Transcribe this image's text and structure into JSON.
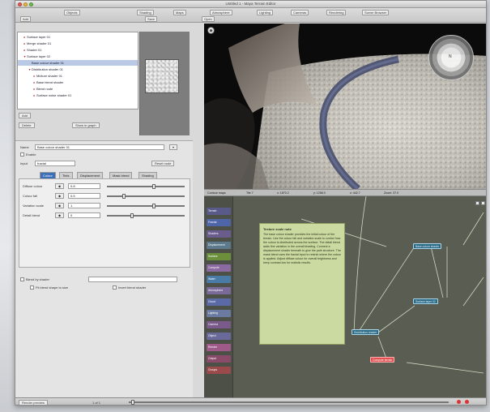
{
  "window": {
    "title": "Untitled 1 - Maya Terrain Editor"
  },
  "toolbar": {
    "top_buttons": [
      "Objects",
      "Shading",
      "Maps",
      "Atmosphere",
      "Lighting",
      "Cameras",
      "Rendering",
      "Scene Browser"
    ],
    "small_buttons": [
      "Add",
      "Save",
      "Open"
    ]
  },
  "outliner": {
    "items": [
      {
        "label": "Surface layer 01",
        "indent": 1,
        "toggle": "▸"
      },
      {
        "label": "Merge shader 01",
        "indent": 1,
        "toggle": "▸"
      },
      {
        "label": "Shader 01",
        "indent": 1,
        "toggle": "▸"
      },
      {
        "label": "Surface layer 02",
        "indent": 1,
        "toggle": "▾"
      },
      {
        "label": "Base colour shader 01",
        "indent": 2,
        "toggle": "",
        "selected": true
      },
      {
        "label": "Distribution shader 01",
        "indent": 2,
        "toggle": "▾"
      },
      {
        "label": "Mixture shader 01",
        "indent": 3,
        "toggle": "▸"
      },
      {
        "label": "Base blend shader",
        "indent": 3,
        "toggle": "▸"
      },
      {
        "label": "Blend node",
        "indent": 3,
        "toggle": "▸"
      },
      {
        "label": "Surface noise shader 01",
        "indent": 3,
        "toggle": "▸"
      }
    ],
    "buttons": [
      "Add",
      "Delete",
      "Show in graph"
    ]
  },
  "attributes": {
    "name_label": "Name",
    "name_value": "Base colour shader 01",
    "enable_label": "Enable",
    "input_label": "Input",
    "input_value": "fractal",
    "reset_button": "Reset node",
    "tabs": [
      "Colour",
      "Tints",
      "Displacement",
      "Mask blend",
      "Shading"
    ],
    "rows": [
      {
        "label": "Diffuse colour",
        "value": "0.8"
      },
      {
        "label": "Colour fall",
        "value": "0.5"
      },
      {
        "label": "Variation scale",
        "value": "1"
      },
      {
        "label": "Detail blend",
        "value": "0"
      }
    ],
    "slider_levels": [
      0.6,
      0.2,
      0.6,
      0.3
    ],
    "blend_label": "Blend by shader",
    "opt_a": "Fit blend shape to size",
    "opt_b": "Invert blend shader"
  },
  "viewport": {
    "compass_label": "N",
    "info": [
      "Contour maps",
      "Tile 7",
      "x: 1870.2",
      "y: 1258.0",
      "z: 442.7",
      "Zoom: 37.0"
    ]
  },
  "graph": {
    "side_nodes": [
      {
        "label": "Terrain",
        "color": "#5a5a8a"
      },
      {
        "label": "Fractal",
        "color": "#4e66a8"
      },
      {
        "label": "Shaders",
        "color": "#6a5c8c"
      },
      {
        "label": "Displacement",
        "color": "#5c7a8c"
      },
      {
        "label": "Surface",
        "color": "#6b8f3a"
      },
      {
        "label": "Compute",
        "color": "#8a6aa0"
      },
      {
        "label": "Water",
        "color": "#4a7aa6"
      },
      {
        "label": "Atmosphere",
        "color": "#7a6a9a"
      },
      {
        "label": "Cloud",
        "color": "#5a6aa6"
      },
      {
        "label": "Lighting",
        "color": "#6a7aa0"
      },
      {
        "label": "Camera",
        "color": "#7a5a8a"
      },
      {
        "label": "Object",
        "color": "#6a6a9a"
      },
      {
        "label": "Render",
        "color": "#a05a8a"
      },
      {
        "label": "Output",
        "color": "#8a4a6a"
      },
      {
        "label": "Groups",
        "color": "#9a4a4a"
      }
    ],
    "note_title": "Texture scale note",
    "note_text": "The base colour shader provides the initial colour of the terrain. Use the colour fall and variation scale to control how the colour is distributed across the surface. The detail blend adds fine variation in the overall shading. Connect a displacement shader beneath to give the path structure. The mask blend uses the fractal input to restrict where the colour is applied. Adjust diffuse colour for overall brightness and keep contrast low for realistic results.",
    "nodes": [
      {
        "label": "Base colour shader",
        "color": "normal"
      },
      {
        "label": "Surface layer 02",
        "color": "normal"
      },
      {
        "label": "Distribution shader",
        "color": "normal"
      },
      {
        "label": "Compute terrain",
        "color": "red"
      }
    ]
  },
  "status": {
    "left": "Render preview",
    "frame": "1 of 1"
  }
}
